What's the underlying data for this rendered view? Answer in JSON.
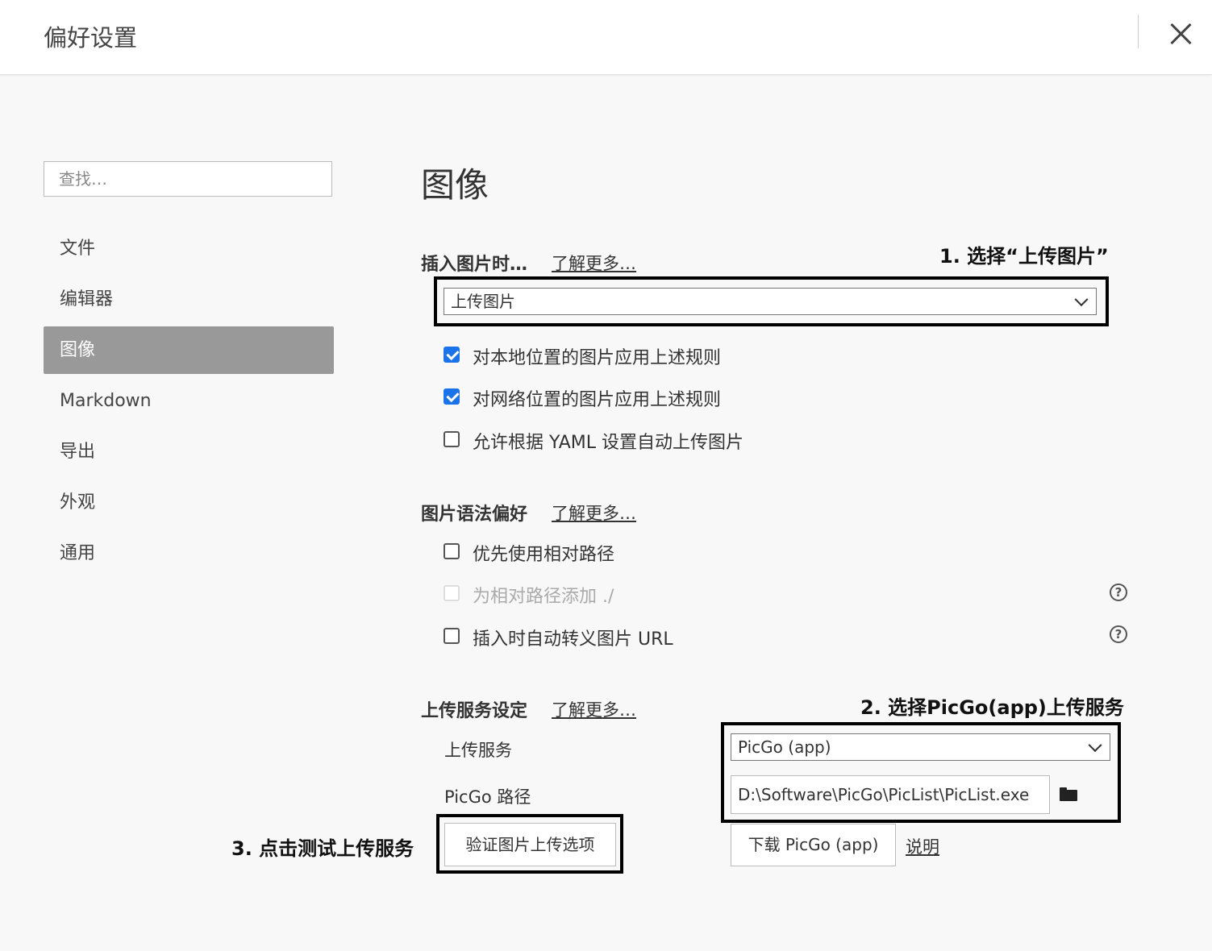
{
  "window": {
    "title": "偏好设置"
  },
  "search": {
    "placeholder": "查找…"
  },
  "sidebar": {
    "items": [
      {
        "label": "文件"
      },
      {
        "label": "编辑器"
      },
      {
        "label": "图像"
      },
      {
        "label": "Markdown"
      },
      {
        "label": "导出"
      },
      {
        "label": "外观"
      },
      {
        "label": "通用"
      }
    ]
  },
  "page": {
    "heading": "图像"
  },
  "insert": {
    "title": "插入图片时…",
    "learn_more": "了解更多…",
    "annotation": "1. 选择“上传图片”",
    "select_value": "上传图片",
    "options": [
      {
        "label": "对本地位置的图片应用上述规则",
        "checked": true
      },
      {
        "label": "对网络位置的图片应用上述规则",
        "checked": true
      },
      {
        "label": "允许根据 YAML 设置自动上传图片",
        "checked": false
      }
    ]
  },
  "syntax": {
    "title": "图片语法偏好",
    "learn_more": "了解更多…",
    "options": [
      {
        "label": "优先使用相对路径",
        "checked": false
      },
      {
        "label": "为相对路径添加 ./",
        "checked": false,
        "disabled": true
      },
      {
        "label": "插入时自动转义图片 URL",
        "checked": false
      }
    ]
  },
  "upload": {
    "title": "上传服务设定",
    "learn_more": "了解更多…",
    "annotation": "2. 选择PicGo(app)上传服务",
    "service_label": "上传服务",
    "service_value": "PicGo (app)",
    "path_label": "PicGo 路径",
    "path_value": "D:\\Software\\PicGo\\PicList\\PicList.exe",
    "verify_button": "验证图片上传选项",
    "verify_annotation": "3. 点击测试上传服务",
    "download_button": "下载 PicGo (app)",
    "help_link": "说明"
  },
  "colors": {
    "accent": "#1a73e8",
    "active_nav": "#999999"
  }
}
